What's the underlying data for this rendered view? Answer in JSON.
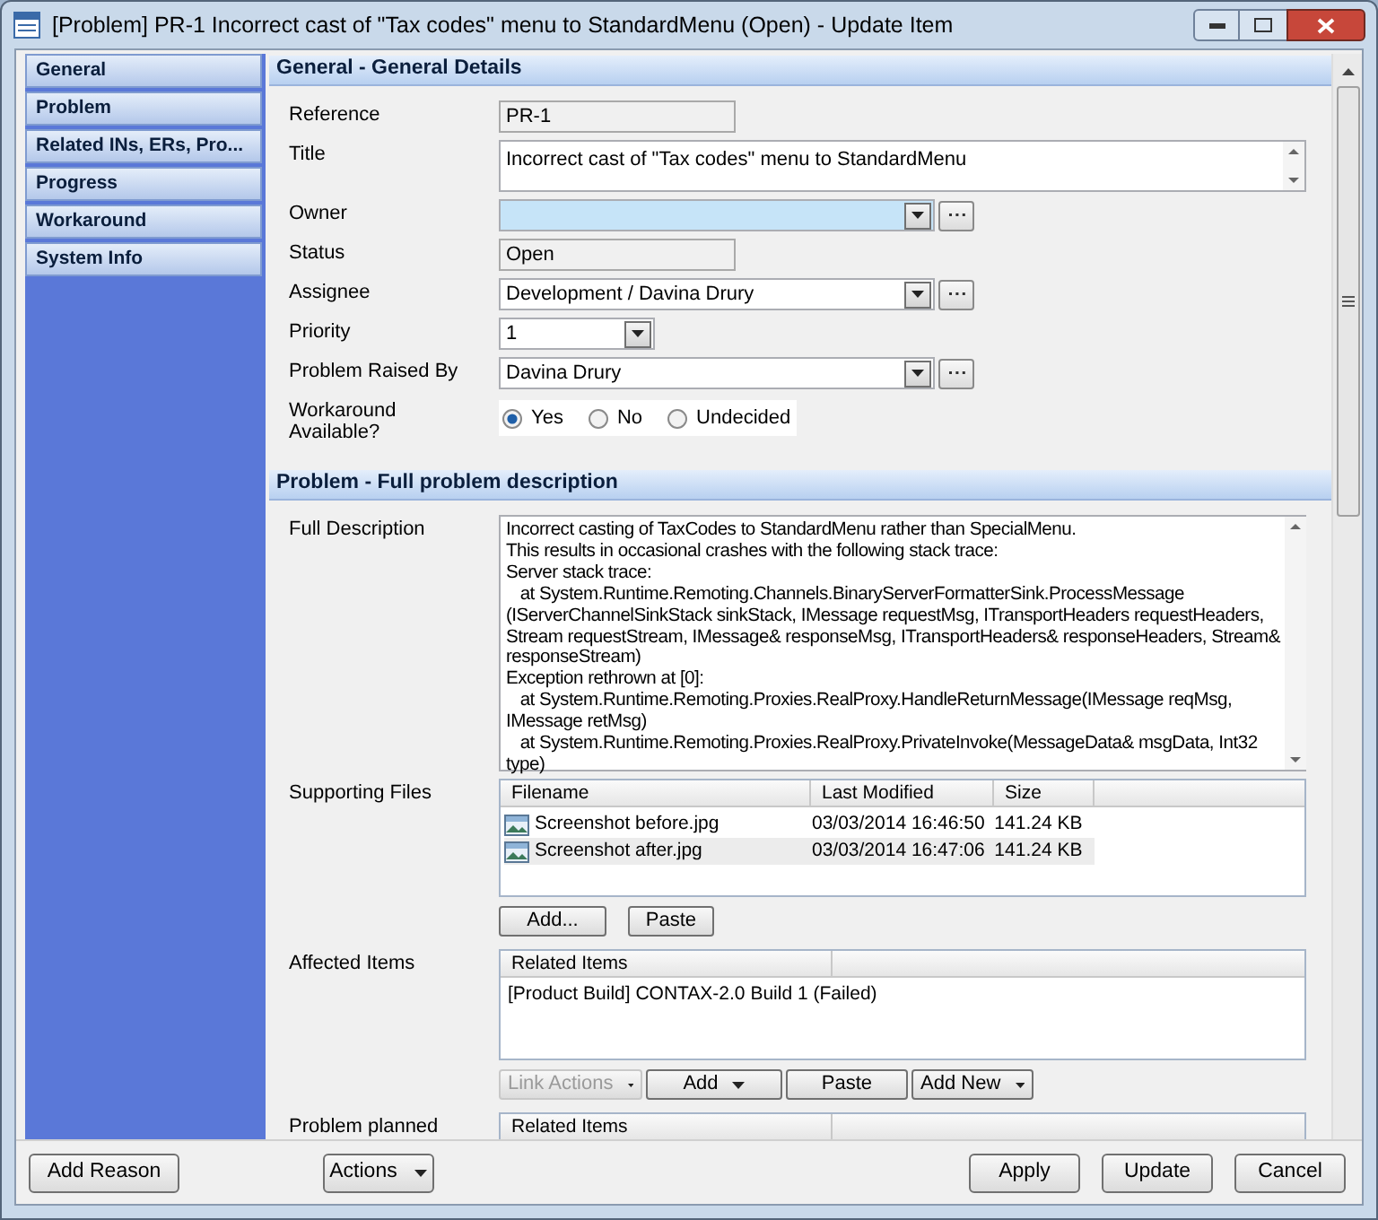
{
  "window": {
    "title": "[Problem] PR-1 Incorrect cast of \"Tax codes\" menu to StandardMenu (Open) - Update Item"
  },
  "sidebar": {
    "items": [
      {
        "label": "General"
      },
      {
        "label": "Problem"
      },
      {
        "label": "Related INs, ERs, Pro..."
      },
      {
        "label": "Progress"
      },
      {
        "label": "Workaround"
      },
      {
        "label": "System Info"
      }
    ]
  },
  "sections": [
    {
      "title": "General - General Details",
      "fields": [
        {
          "kind": "readonly",
          "label": "Reference",
          "value": "PR-1"
        },
        {
          "kind": "textarea",
          "label": "Title",
          "value": "Incorrect cast of \"Tax codes\" menu to StandardMenu"
        },
        {
          "kind": "combo",
          "label": "Owner",
          "focused": true
        },
        {
          "kind": "readonly",
          "label": "Status",
          "value": "Open"
        },
        {
          "kind": "combo",
          "label": "Assignee",
          "value": "Development / Davina Drury",
          "focused": false
        },
        {
          "kind": "select",
          "label": "Priority",
          "value": "1"
        },
        {
          "kind": "combo",
          "label": "Problem Raised By",
          "value": "Davina Drury",
          "focused": false
        },
        {
          "kind": "radio",
          "label": "Workaround Available?",
          "options": [
            {
              "label": "Yes",
              "selected": true
            },
            {
              "label": "No",
              "selected": false
            },
            {
              "label": "Undecided",
              "selected": false
            }
          ]
        }
      ]
    },
    {
      "title": "Problem - Full problem description",
      "fields": [
        {
          "kind": "memo",
          "label": "Full Description",
          "lines": [
            "Incorrect casting of TaxCodes to StandardMenu rather than SpecialMenu.",
            "This results in occasional crashes with the following stack trace:",
            "Server stack trace:",
            "   at System.Runtime.Remoting.Channels.BinaryServerFormatterSink.ProcessMessage",
            "(IServerChannelSinkStack sinkStack, IMessage requestMsg, ITransportHeaders requestHeaders,",
            "Stream requestStream, IMessage& responseMsg, ITransportHeaders& responseHeaders, Stream&",
            "responseStream)",
            "Exception rethrown at [0]:",
            "   at System.Runtime.Remoting.Proxies.RealProxy.HandleReturnMessage(IMessage reqMsg,",
            "IMessage retMsg)",
            "   at System.Runtime.Remoting.Proxies.RealProxy.PrivateInvoke(MessageData& msgData, Int32",
            "type)"
          ]
        },
        {
          "kind": "files",
          "label": "Supporting Files",
          "columns": [
            "Filename",
            "Last Modified",
            "Size"
          ],
          "rows": [
            {
              "cells": [
                "Screenshot before.jpg",
                "03/03/2014 16:46:50",
                "141.24 KB"
              ],
              "selected": false
            },
            {
              "cells": [
                "Screenshot after.jpg",
                "03/03/2014 16:47:06",
                "141.24 KB"
              ],
              "selected": true
            }
          ],
          "buttons": [
            {
              "label": "Add...",
              "dropdown": false,
              "disabled": false
            },
            {
              "label": "Paste",
              "dropdown": false,
              "disabled": false
            }
          ]
        },
        {
          "kind": "links",
          "label": "Affected Items",
          "columns": [
            "Related Items"
          ],
          "rows": [
            "[Product Build] CONTAX-2.0 Build 1 (Failed)"
          ],
          "buttons": [
            {
              "label": "Link Actions",
              "dropdown": true,
              "disabled": true
            },
            {
              "label": "Add",
              "dropdown": true,
              "disabled": false
            },
            {
              "label": "Paste",
              "dropdown": false,
              "disabled": false
            },
            {
              "label": "Add New",
              "dropdown": true,
              "disabled": false
            }
          ]
        },
        {
          "kind": "links",
          "label": "Problem planned",
          "columns": [
            "Related Items"
          ]
        }
      ]
    }
  ],
  "footer": {
    "left": [
      {
        "label": "Add Reason",
        "dropdown": false
      },
      {
        "label": "Actions",
        "dropdown": true
      }
    ],
    "right": [
      {
        "label": "Apply",
        "dropdown": false
      },
      {
        "label": "Update",
        "dropdown": false
      },
      {
        "label": "Cancel",
        "dropdown": false
      }
    ]
  }
}
